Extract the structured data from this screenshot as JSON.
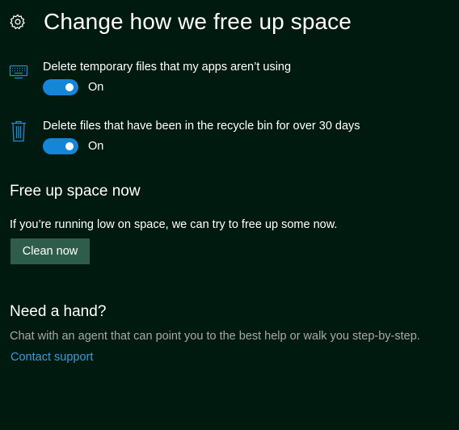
{
  "header": {
    "icon": "gear-icon",
    "title": "Change how we free up space"
  },
  "settings": [
    {
      "icon": "keyboard-icon",
      "label": "Delete temporary files that my apps aren’t using",
      "toggle_on": true,
      "toggle_state": "On"
    },
    {
      "icon": "trash-icon",
      "label": "Delete files that have been in the recycle bin for over 30 days",
      "toggle_on": true,
      "toggle_state": "On"
    }
  ],
  "free_up": {
    "heading": "Free up space now",
    "description": "If you’re running low on space, we can try to free up some now.",
    "button_label": "Clean now"
  },
  "help": {
    "heading": "Need a hand?",
    "description": "Chat with an agent that can point you to the best help or walk you step-by-step.",
    "link_label": "Contact support"
  },
  "colors": {
    "background": "#001a0f",
    "accent": "#1585d8",
    "button": "#2f5d4b",
    "link": "#3a9be0",
    "muted_text": "#a8a8a8"
  }
}
